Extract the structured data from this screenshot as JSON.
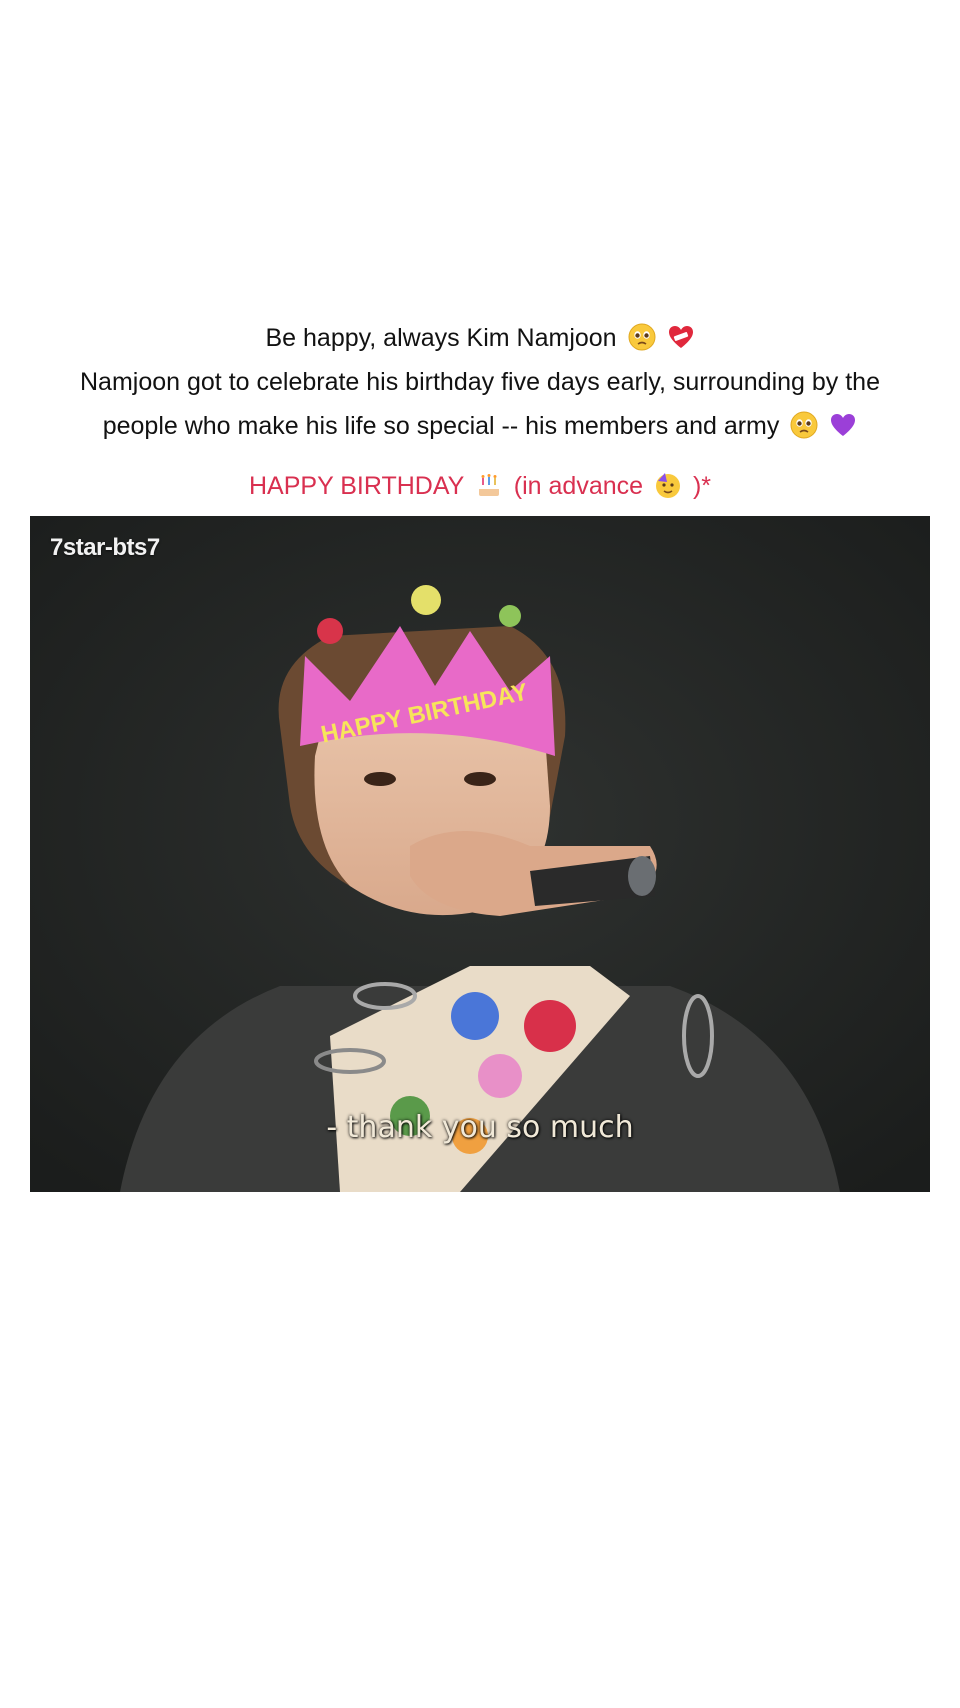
{
  "post": {
    "line1": "Be happy, always Kim Namjoon",
    "line2": "Namjoon got to celebrate his birthday five days early, surrounding by the people who make his life so special -- his members and army",
    "birthday_text": "HAPPY BIRTHDAY",
    "advance_text": "(in advance",
    "closing_text": ")*"
  },
  "video": {
    "watermark": "7star-bts7",
    "subtitle": "- thank you so much",
    "crown_text": "HAPPY BIRTHDAY"
  },
  "icons": {
    "line1_emojis": [
      "teary-face-icon",
      "mending-heart-icon"
    ],
    "line2_emojis": [
      "teary-face-icon",
      "purple-heart-icon"
    ],
    "birthday_emojis": [
      "birthday-cake-icon",
      "party-face-icon"
    ]
  },
  "colors": {
    "background": "#ffffff",
    "caption_text": "#121212",
    "birthday_text": "#d93050",
    "video_bg": "#242624",
    "subtitle": "#f1e9d8",
    "crown": "#e86ac8"
  }
}
